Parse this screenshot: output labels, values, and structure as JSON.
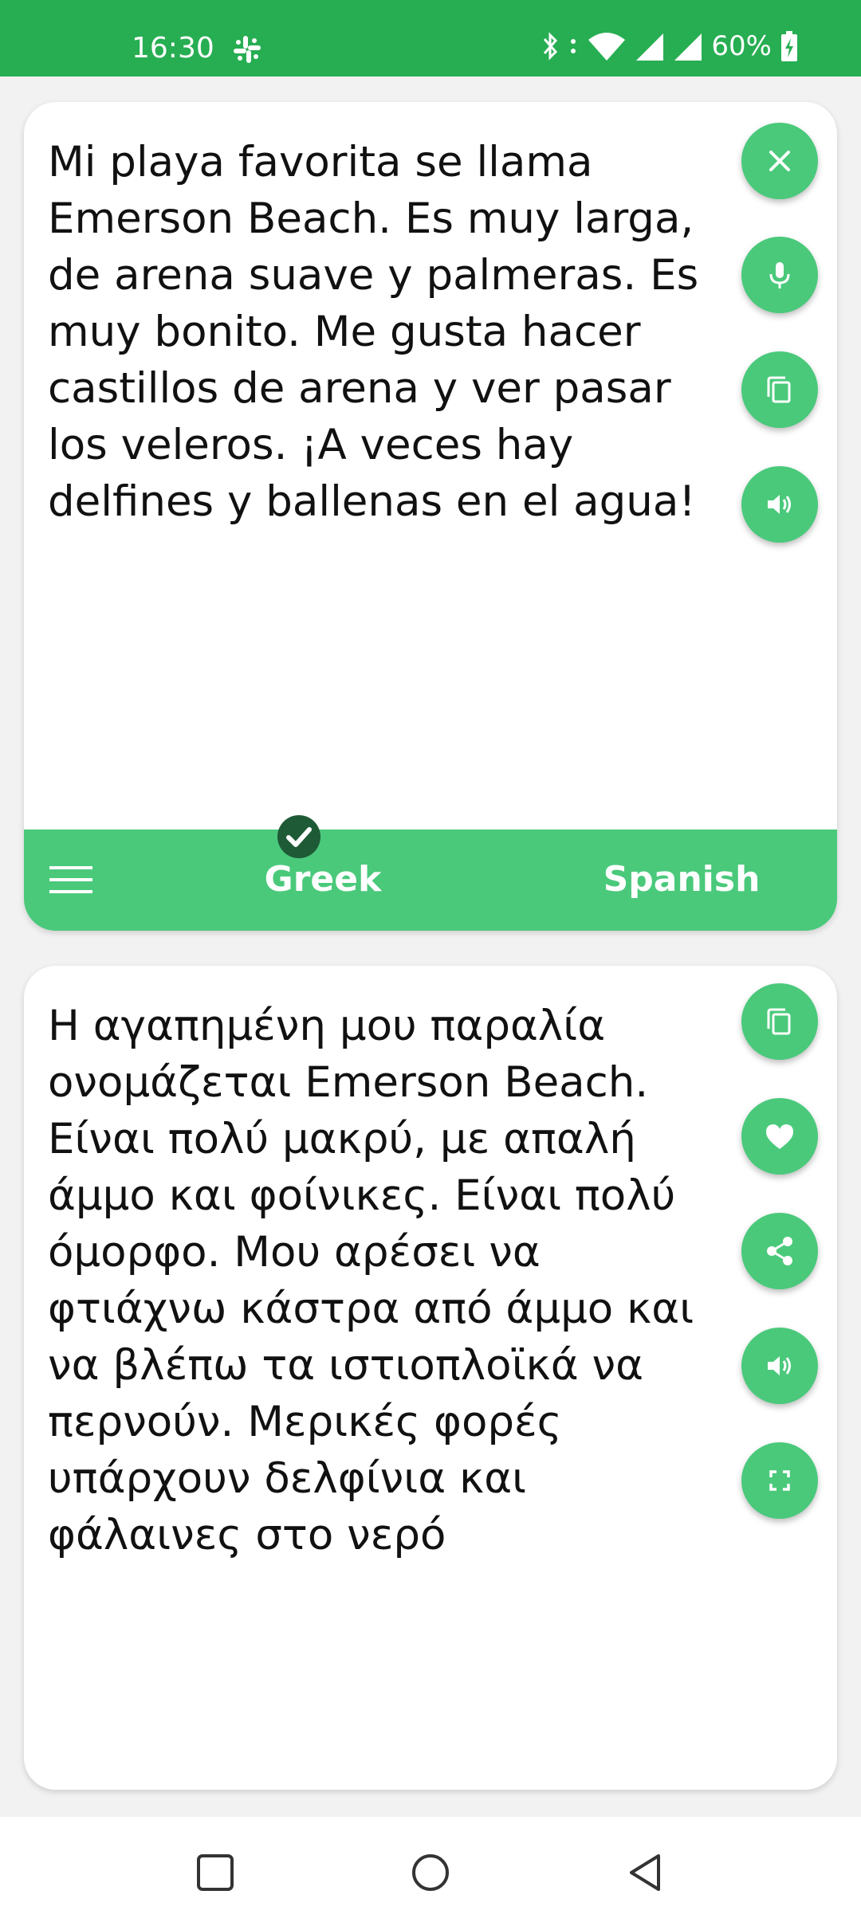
{
  "status_bar": {
    "time": "16:30",
    "battery_percent": "60%",
    "icons": [
      "slack-icon",
      "bluetooth-icon",
      "vibrate-icon",
      "wifi-icon",
      "signal-icon",
      "signal-icon",
      "battery-charging-icon"
    ]
  },
  "source_panel": {
    "text": "Mi playa favorita se llama Emerson Beach. Es muy larga, de arena suave y palmeras. Es muy bonito. Me gusta hacer castillos de arena y ver pasar los veleros. ¡A veces hay delfines y ballenas en el agua!",
    "actions": [
      "clear",
      "microphone",
      "copy",
      "speak"
    ]
  },
  "language_bar": {
    "source_language": "Greek",
    "target_language": "Spanish",
    "selected": "Greek"
  },
  "result_panel": {
    "text": "Η αγαπημένη μου παραλία ονομάζεται Emerson Beach. Είναι πολύ μακρύ, με απαλή άμμο και φοίνικες. Είναι πολύ όμορφο. Μου αρέσει να φτιάχνω κάστρα από άμμο και να βλέπω τα ιστιοπλοϊκά να περνούν. Μερικές φορές υπάρχουν δελφίνια και φάλαινες στο νερό",
    "actions": [
      "copy",
      "favorite",
      "share",
      "speak",
      "fullscreen"
    ]
  },
  "colors": {
    "status_bar": "#27ae52",
    "accent": "#4ac97b",
    "check_badge": "#1e5a36"
  },
  "nav_bar": {
    "buttons": [
      "recents",
      "home",
      "back"
    ]
  }
}
